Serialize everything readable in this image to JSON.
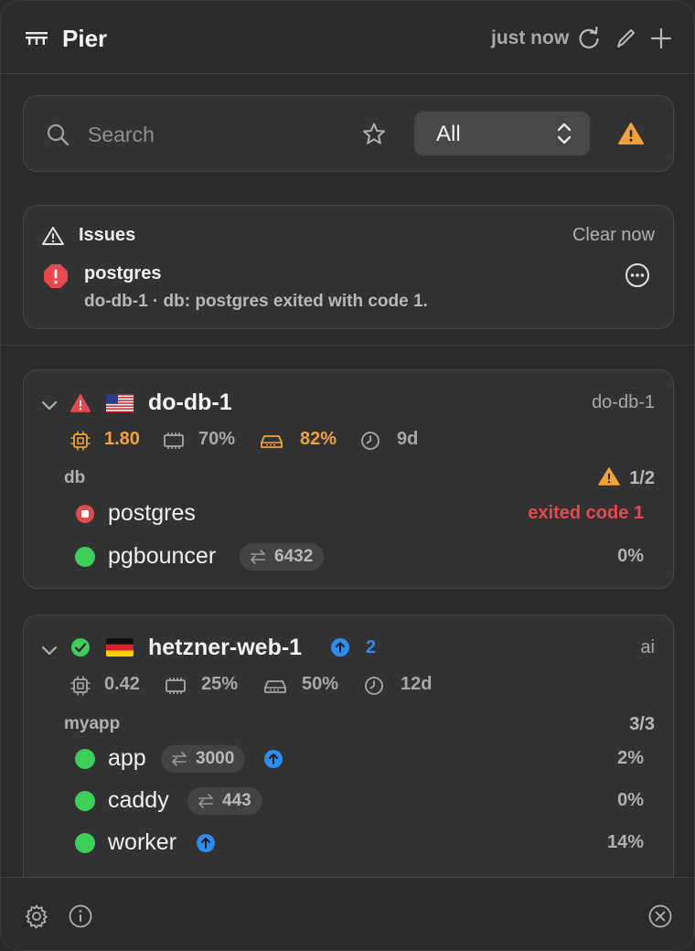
{
  "header": {
    "app_title": "Pier",
    "updated": "just now",
    "icons": [
      "pier-logo-icon",
      "refresh-icon",
      "edit-icon",
      "add-icon"
    ]
  },
  "search": {
    "placeholder": "Search",
    "filter_value": "All"
  },
  "issues": {
    "title": "Issues",
    "clear_label": "Clear now",
    "items": [
      {
        "name": "postgres",
        "detail": "do-db-1 · db: postgres exited with code 1."
      }
    ]
  },
  "hosts": [
    {
      "name": "do-db-1",
      "flag": "us",
      "status": "warning",
      "right_label": "do-db-1",
      "metrics": {
        "cpu": "1.80",
        "memory": "70%",
        "disk": "82%",
        "uptime": "9d"
      },
      "groups": [
        {
          "name": "db",
          "count": "1/2",
          "services": [
            {
              "name": "postgres",
              "status": "error",
              "right": "exited code 1"
            },
            {
              "name": "pgbouncer",
              "status": "running",
              "port": "6432",
              "right": "0%"
            }
          ]
        }
      ]
    },
    {
      "name": "hetzner-web-1",
      "flag": "de",
      "status": "ok",
      "updates": "2",
      "right_label": "ai",
      "metrics": {
        "cpu": "0.42",
        "memory": "25%",
        "disk": "50%",
        "uptime": "12d"
      },
      "groups": [
        {
          "name": "myapp",
          "count": "3/3",
          "services": [
            {
              "name": "app",
              "status": "running",
              "port": "3000",
              "update": true,
              "right": "2%"
            },
            {
              "name": "caddy",
              "status": "running",
              "port": "443",
              "right": "0%"
            },
            {
              "name": "worker",
              "status": "running",
              "update": true,
              "right": "14%"
            }
          ]
        }
      ]
    }
  ],
  "colors": {
    "warning": "#f5a13a",
    "error": "#e5484d",
    "running": "#3ecf5a",
    "info": "#2d8cf0",
    "muted": "#a8a8a8"
  },
  "footer": {
    "icons": [
      "settings-icon",
      "info-icon",
      "close-icon"
    ]
  }
}
